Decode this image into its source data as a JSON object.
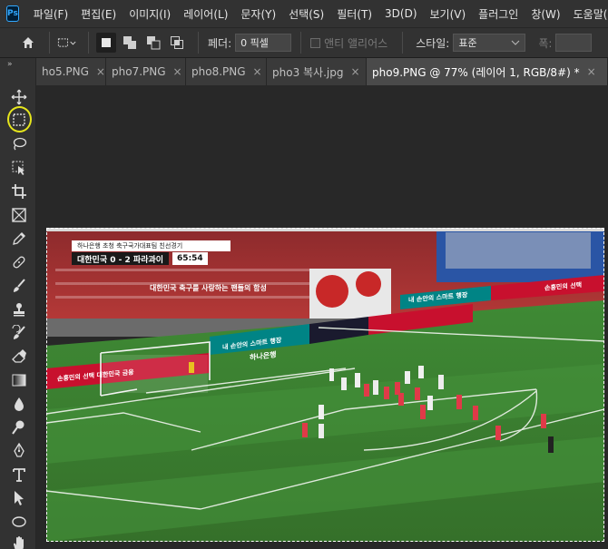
{
  "app": {
    "logo": "Ps"
  },
  "menu": [
    "파일(F)",
    "편집(E)",
    "이미지(I)",
    "레이어(L)",
    "문자(Y)",
    "선택(S)",
    "필터(T)",
    "3D(D)",
    "보기(V)",
    "플러그인",
    "창(W)",
    "도움말(H)"
  ],
  "options": {
    "feather_label": "페더:",
    "feather_value": "0 픽셀",
    "antialias_label": "앤티 앨리어스",
    "style_label": "스타일:",
    "style_value": "표준",
    "width_label": "폭:"
  },
  "tabs": [
    {
      "label": "ho5.PNG",
      "close": "×"
    },
    {
      "label": "pho7.PNG",
      "close": "×"
    },
    {
      "label": "pho8.PNG",
      "close": "×"
    },
    {
      "label": "pho3 복사.jpg",
      "close": "×"
    },
    {
      "label": "pho9.PNG @ 77% (레이어 1, RGB/8#) *",
      "close": "×"
    }
  ],
  "tools": [
    "move-tool-icon",
    "rectangular-marquee-icon",
    "lasso-icon",
    "object-select-icon",
    "crop-icon",
    "frame-icon",
    "eyedropper-icon",
    "healing-brush-icon",
    "brush-icon",
    "clone-stamp-icon",
    "history-brush-icon",
    "eraser-icon",
    "gradient-icon",
    "blur-icon",
    "dodge-icon",
    "pen-icon",
    "type-icon",
    "path-select-icon",
    "ellipse-icon",
    "hand-icon"
  ],
  "photo": {
    "score_title": "하나은행 초청 축구국가대표팀 친선경기",
    "score_line": "대한민국  0 - 2  파라과이",
    "clock": "65:54",
    "boards": [
      "손흥민의 선택 대한민국 금융",
      "내 손안의 스마트 행장",
      "하나은행",
      "내 손안의 스마트 행장",
      "손흥민의 선택"
    ],
    "banner_text": "대한민국 축구를 사랑하는 팬들의 함성"
  },
  "colors": {
    "highlight": "#e6e61c",
    "ui_bg": "#323232",
    "canvas_bg": "#282828",
    "pitch": "#3f7d2e",
    "board_red": "#c8102e",
    "board_teal": "#008485"
  }
}
